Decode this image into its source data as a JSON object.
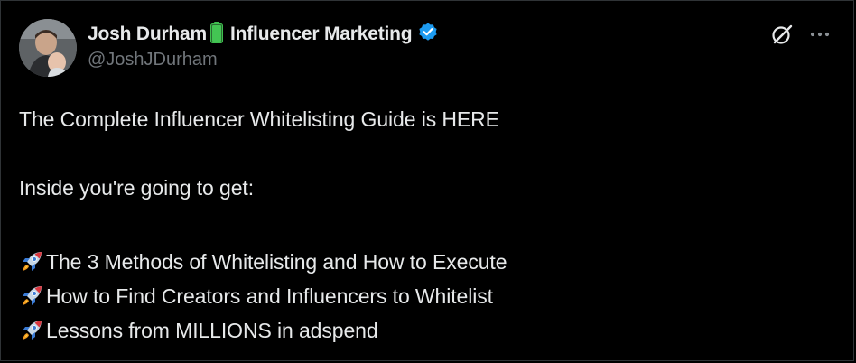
{
  "author": {
    "display_name": "Josh Durham",
    "name_suffix": "Influencer Marketing",
    "handle": "@JoshJDurham",
    "verified_color": "#1d9bf0",
    "battery_color": "#3fbf4f"
  },
  "post": {
    "line1": "The Complete Influencer Whitelisting Guide is HERE",
    "line2": "Inside you're going to get:",
    "items": [
      {
        "icon": "rocket-icon",
        "text": "The 3 Methods of Whitelisting and How to Execute"
      },
      {
        "icon": "rocket-icon",
        "text": "How to Find Creators and Influencers to Whitelist"
      },
      {
        "icon": "rocket-icon",
        "text": "Lessons from MILLIONS in adspend"
      }
    ]
  },
  "actions": {
    "grok_icon": "grok-icon",
    "more_icon": "more-icon"
  }
}
